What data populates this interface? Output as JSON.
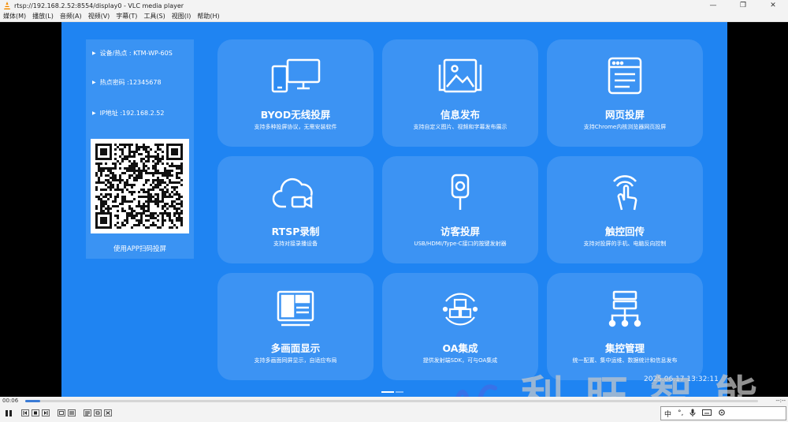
{
  "window": {
    "title": "rtsp://192.168.2.52:8554/display0 - VLC media player",
    "min_glyph": "—",
    "max_glyph": "❐",
    "close_glyph": "✕"
  },
  "menu": [
    "媒体(M)",
    "播放(L)",
    "音频(A)",
    "视频(V)",
    "字幕(T)",
    "工具(S)",
    "视图(I)",
    "帮助(H)"
  ],
  "info": {
    "device": "设备/热点 : KTM-WP-60S",
    "password": "热点密码 :12345678",
    "ip": "IP地址 :192.168.2.52",
    "qr_caption": "使用APP扫码投屏"
  },
  "cards": [
    {
      "icon": "devices-icon",
      "title": "BYOD无线投屏",
      "desc": "支持多种投屏协议，无需安装软件"
    },
    {
      "icon": "image-gallery-icon",
      "title": "信息发布",
      "desc": "支持自定义图片、视频和字幕发布展示"
    },
    {
      "icon": "browser-icon",
      "title": "网页投屏",
      "desc": "支持Chrome内核浏览器网页投屏"
    },
    {
      "icon": "cloud-camera-icon",
      "title": "RTSP录制",
      "desc": "支持对接录播设备"
    },
    {
      "icon": "transmitter-icon",
      "title": "访客投屏",
      "desc": "USB/HDMI/Type-C接口的按键发射器"
    },
    {
      "icon": "touch-hand-icon",
      "title": "触控回传",
      "desc": "支持对投屏的手机、电脑反向控制"
    },
    {
      "icon": "layout-icon",
      "title": "多画面显示",
      "desc": "支持多画面同屏显示，自适应布局"
    },
    {
      "icon": "oa-cubes-icon",
      "title": "OA集成",
      "desc": "提供发射端SDK，可与OA集成"
    },
    {
      "icon": "network-icon",
      "title": "集控管理",
      "desc": "统一配置、集中运维、数据统计和信息发布"
    }
  ],
  "timestamp": "2025.06.17 13:32:11",
  "watermark": {
    "brand": "利旺智能"
  },
  "player": {
    "elapsed": "00:06",
    "remaining": "--:--",
    "progress": 0.02,
    "ime_lang": "中",
    "ime_punct": "°,"
  },
  "colors": {
    "screen_bg": "#1f84f2",
    "accent": "#3a7bd5"
  }
}
